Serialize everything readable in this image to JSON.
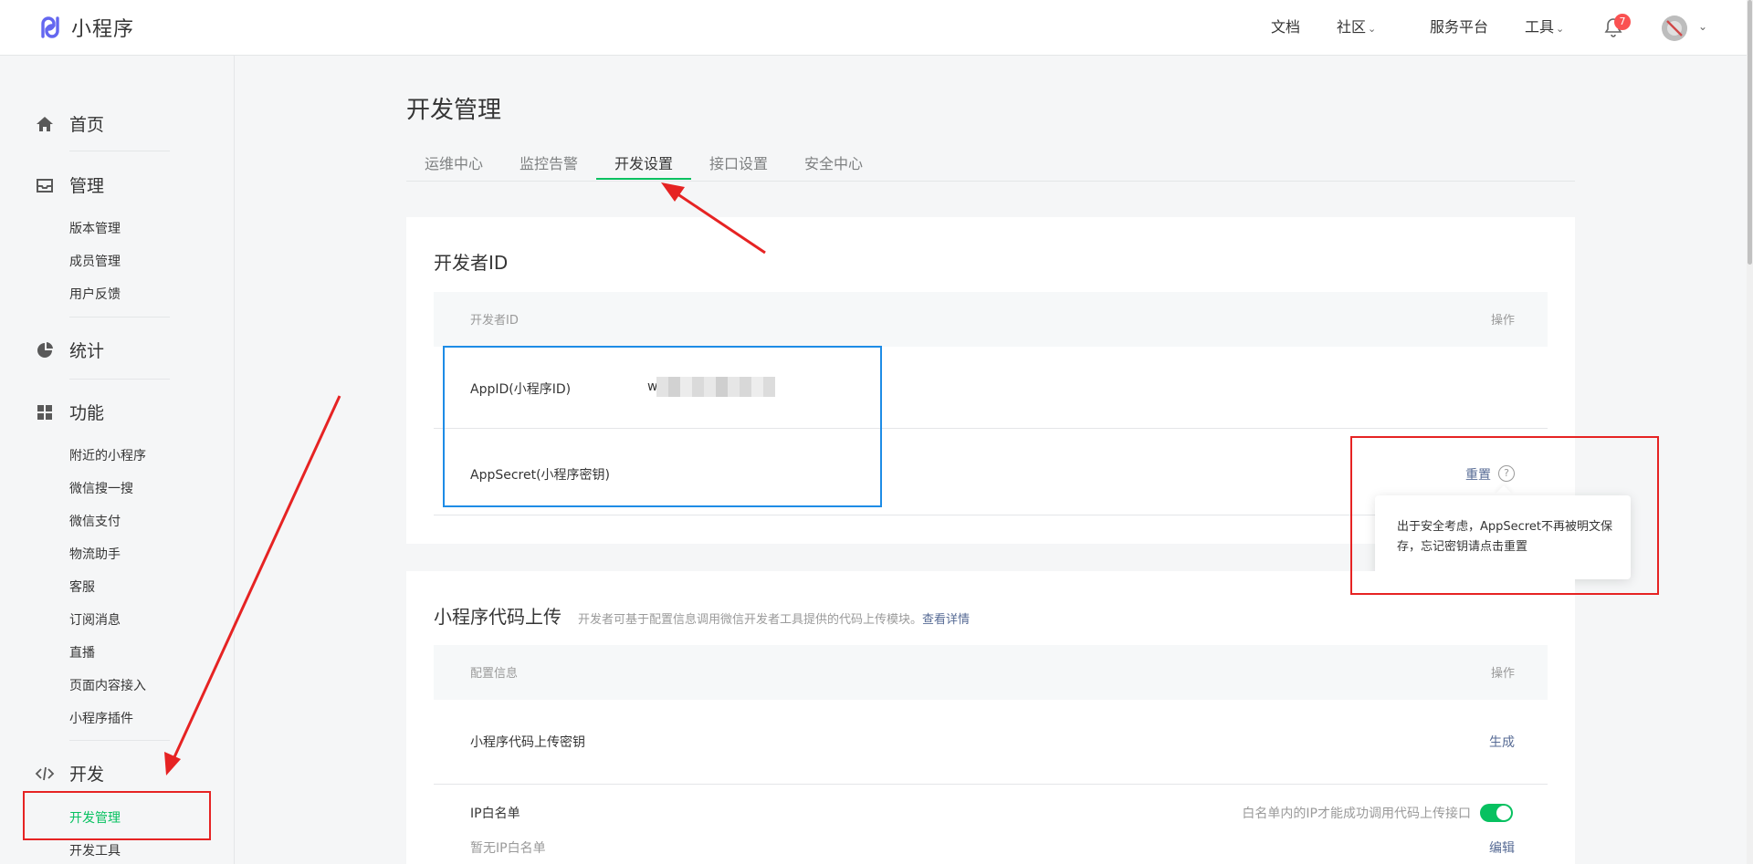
{
  "header": {
    "app_name": "小程序",
    "nav": [
      {
        "label": "文档"
      },
      {
        "label": "社区",
        "has_dropdown": true
      },
      {
        "label": "服务平台"
      },
      {
        "label": "工具",
        "has_dropdown": true
      }
    ],
    "notification_count": "7"
  },
  "sidebar": {
    "sections": [
      {
        "label": "首页",
        "icon": "home-icon"
      },
      {
        "label": "管理",
        "icon": "inbox-icon"
      },
      {
        "label": "统计",
        "icon": "pie-chart-icon"
      },
      {
        "label": "功能",
        "icon": "grid-icon"
      },
      {
        "label": "开发",
        "icon": "code-icon"
      }
    ],
    "manage_items": [
      "版本管理",
      "成员管理",
      "用户反馈"
    ],
    "feature_items": [
      "附近的小程序",
      "微信搜一搜",
      "微信支付",
      "物流助手",
      "客服",
      "订阅消息",
      "直播",
      "页面内容接入",
      "小程序插件"
    ],
    "dev_items": [
      "开发管理",
      "开发工具"
    ],
    "active_item": "开发管理"
  },
  "main": {
    "title": "开发管理",
    "tabs": [
      "运维中心",
      "监控告警",
      "开发设置",
      "接口设置",
      "安全中心"
    ],
    "active_tab": "开发设置"
  },
  "developer_id_card": {
    "title": "开发者ID",
    "col_id": "开发者ID",
    "col_action": "操作",
    "rows": [
      {
        "label": "AppID(小程序ID)",
        "value_prefix": "w"
      },
      {
        "label": "AppSecret(小程序密钥)",
        "action": "重置"
      }
    ],
    "tooltip": "出于安全考虑，AppSecret不再被明文保存，忘记密钥请点击重置"
  },
  "code_upload_card": {
    "title": "小程序代码上传",
    "description": "开发者可基于配置信息调用微信开发者工具提供的代码上传模块。",
    "detail_link": "查看详情",
    "col_config": "配置信息",
    "col_action": "操作",
    "rows": [
      {
        "label": "小程序代码上传密钥",
        "action": "生成"
      },
      {
        "label": "IP白名单",
        "hint": "白名单内的IP才能成功调用代码上传接口",
        "toggle_on": true,
        "sub_label": "暂无IP白名单",
        "action": "编辑"
      }
    ]
  },
  "colors": {
    "accent_green": "#07c160",
    "link_blue": "#576b95",
    "annotation_red": "#e62323",
    "annotation_blue": "#1e8ce6"
  }
}
